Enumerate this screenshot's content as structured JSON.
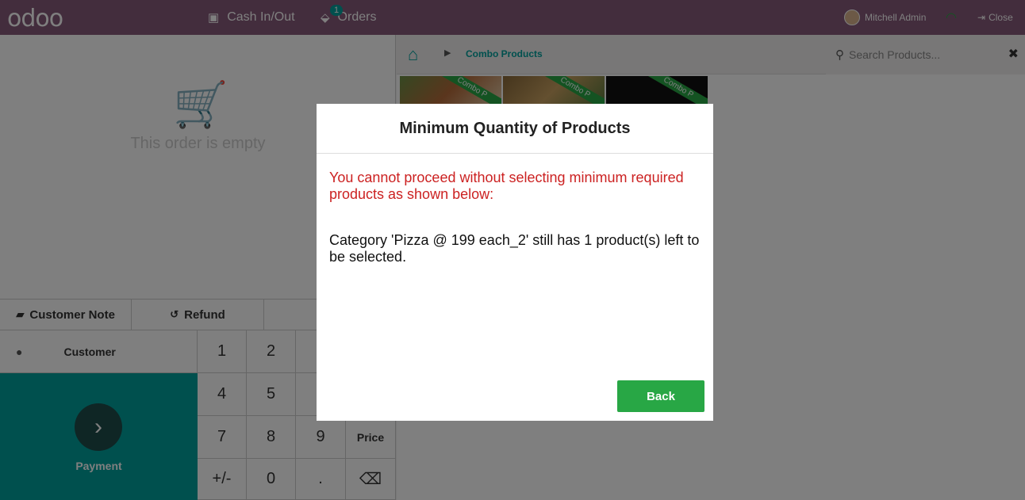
{
  "navbar": {
    "logo": "odoo",
    "cash_in_out": "Cash In/Out",
    "orders": "Orders",
    "orders_badge": "1",
    "user": "Mitchell Admin",
    "close": "Close"
  },
  "order": {
    "empty_text": "This order is empty"
  },
  "controls": {
    "customer_note": "Customer Note",
    "refund": "Refund"
  },
  "customer_label": "Customer",
  "payment_label": "Payment",
  "numpad": {
    "keys": [
      "1",
      "2",
      "",
      "",
      "4",
      "5",
      "",
      "",
      "7",
      "8",
      "9",
      "Price",
      "+/-",
      "0",
      ".",
      "⌫"
    ]
  },
  "breadcrumb": {
    "category": "Combo Products"
  },
  "search": {
    "placeholder": "Search Products..."
  },
  "products": {
    "ribbon": "Combo P"
  },
  "dialog": {
    "title": "Minimum Quantity of Products",
    "message": "You cannot proceed without selecting minimum required products as shown below:",
    "detail": "Category 'Pizza @ 199 each_2' still has 1 product(s) left to be selected.",
    "back": "Back"
  },
  "colors": {
    "navbar": "#875a7b",
    "accent": "#00a09d",
    "button_green": "#28a745",
    "error_red": "#cc2222"
  }
}
